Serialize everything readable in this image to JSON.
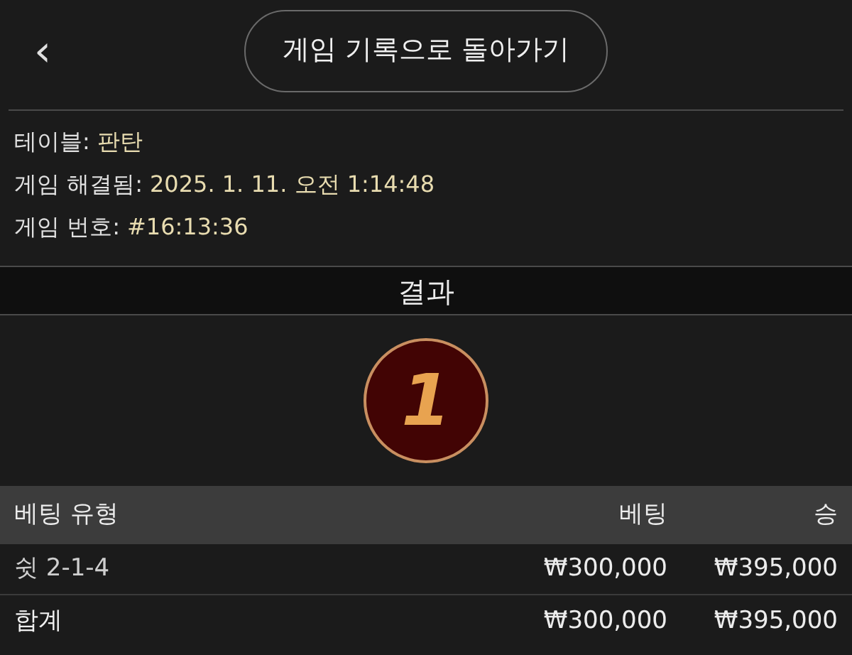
{
  "header": {
    "back_button": "‹",
    "title_button": "게임 기록으로 돌아가기"
  },
  "info": [
    {
      "label": "테이블:",
      "value": "판탄"
    },
    {
      "label": "게임 해결됨:",
      "value": "2025. 1. 11. 오전 1:14:48"
    },
    {
      "label": "게임 번호:",
      "value": "#16:13:36"
    }
  ],
  "result": {
    "title": "결과",
    "number": "1"
  },
  "table": {
    "columns": [
      "베팅 유형",
      "베팅",
      "승"
    ],
    "rows": [
      {
        "kind": "bet",
        "cells": [
          "쉿 2-1-4",
          "₩300,000",
          "₩395,000"
        ]
      },
      {
        "kind": "total",
        "cells": [
          "합계",
          "₩300,000",
          "₩395,000"
        ]
      }
    ]
  }
}
